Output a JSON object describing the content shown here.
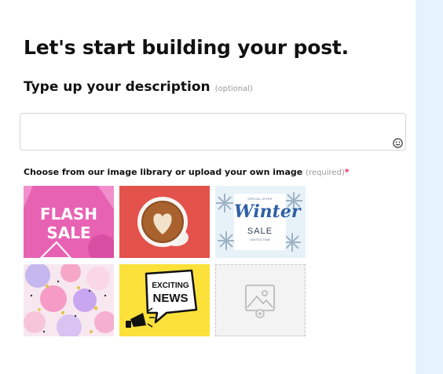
{
  "page": {
    "title": "Let's start building your post."
  },
  "description": {
    "label": "Type up your description",
    "hint": "(optional)",
    "value": ""
  },
  "image_library": {
    "label": "Choose from our image library or upload your own image",
    "hint": "(required)",
    "required_mark": "*",
    "images": [
      {
        "name": "flash-sale",
        "line1": "FLASH",
        "line2": "SALE"
      },
      {
        "name": "coffee-latte-art"
      },
      {
        "name": "winter-sale",
        "small_top": "SPECIAL OFFER",
        "script": "Winter",
        "word": "SALE",
        "small_bottom": "LIMITED TIME"
      },
      {
        "name": "pastel-dots"
      },
      {
        "name": "exciting-news",
        "line1": "EXCITING",
        "line2": "NEWS"
      },
      {
        "name": "upload-image",
        "icon": "image-upload-icon"
      }
    ]
  },
  "colors": {
    "side_strip": "#e4f3fd",
    "required": "#e0245e",
    "flash_bg": "#e862b4",
    "coffee_bg": "#e4524c",
    "news_bg": "#fbe13a"
  }
}
